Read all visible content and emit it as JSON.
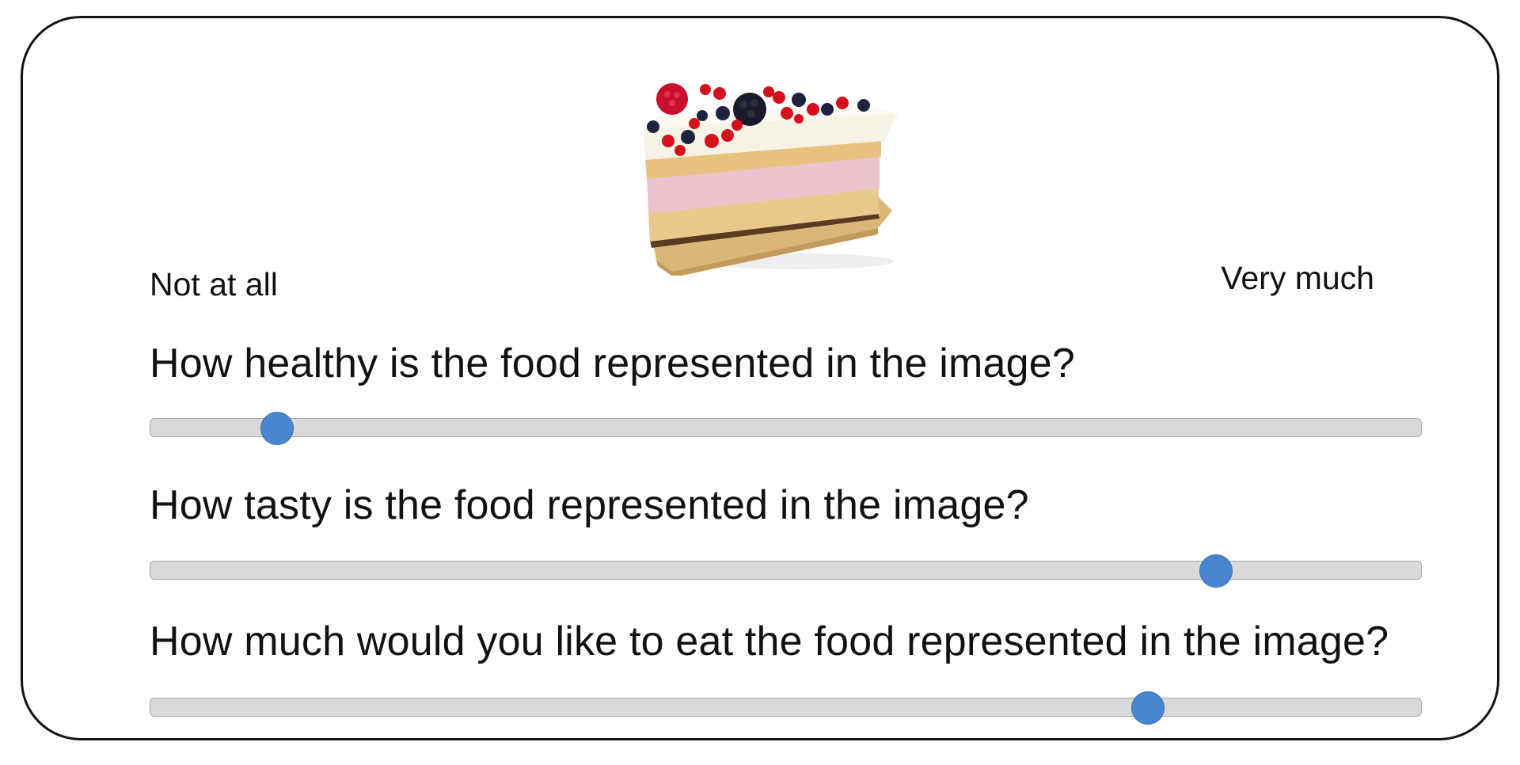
{
  "scale": {
    "min_label": "Not at all",
    "max_label": "Very much"
  },
  "stimulus": {
    "icon": "cake-slice-with-berries-image"
  },
  "questions": [
    {
      "text": "How healthy is the food represented in the image?",
      "value": 0.1
    },
    {
      "text": "How tasty is the food represented in the image?",
      "value": 0.838
    },
    {
      "text": "How much would you like to eat the food represented in the image?",
      "value": 0.785
    }
  ],
  "colors": {
    "thumb": "#4a86cf",
    "track": "#d9d9d9",
    "frame_border": "#111111"
  }
}
